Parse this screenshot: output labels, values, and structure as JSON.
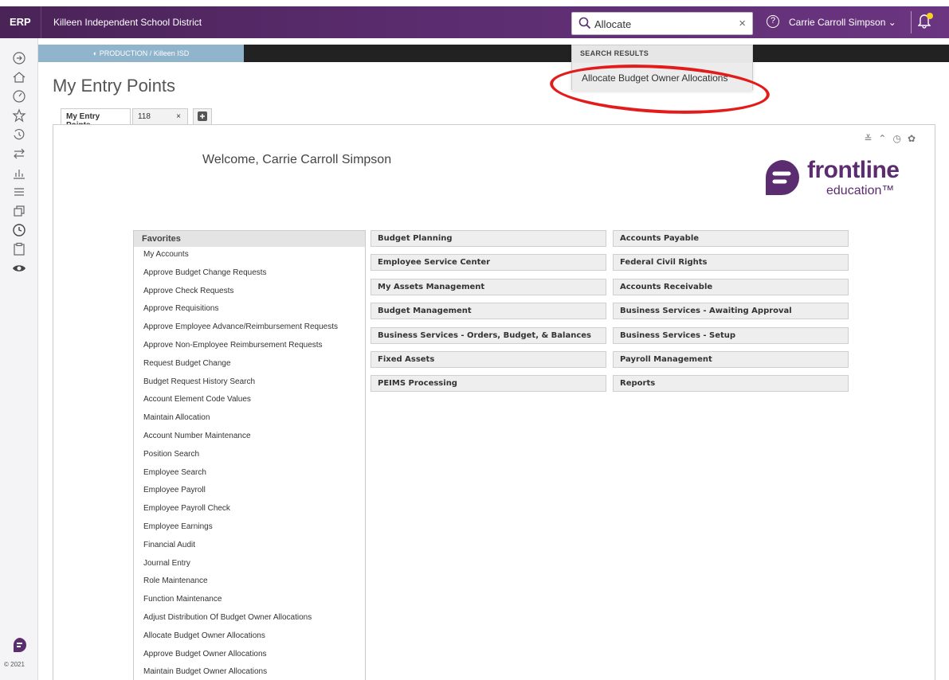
{
  "header": {
    "app": "ERP",
    "district": "Killeen Independent School District",
    "search_value": "Allocate",
    "user": "Carrie Carroll Simpson ⌄"
  },
  "env": {
    "label": "◐ PRODUCTION / Killeen ISD"
  },
  "search_results": {
    "header": "SEARCH RESULTS",
    "match": "Allocate",
    "rest": " Budget Owner Allocations"
  },
  "page": {
    "title": "My Entry Points",
    "tabs": [
      {
        "label": "My Entry Points"
      },
      {
        "label": "118"
      }
    ],
    "welcome": "Welcome, Carrie Carroll Simpson"
  },
  "brand": {
    "name": "frontline",
    "sub": "education™"
  },
  "favorites": {
    "title": "Favorites",
    "items": [
      "My Accounts",
      "Approve Budget Change Requests",
      "Approve Check Requests",
      "Approve Requisitions",
      "Approve Employee Advance/Reimbursement Requests",
      "Approve Non-Employee Reimbursement Requests",
      "Request Budget Change",
      "Budget Request History Search",
      "Account Element Code Values",
      "Maintain Allocation",
      "Account Number Maintenance",
      "Position Search",
      "Employee Search",
      "Employee Payroll",
      "Employee Payroll Check",
      "Employee Earnings",
      "Financial Audit",
      "Journal Entry",
      "Role Maintenance",
      "Function Maintenance",
      "Adjust Distribution Of Budget Owner Allocations",
      "Allocate Budget Owner Allocations",
      "Approve Budget Owner Allocations",
      "Maintain Budget Owner Allocations"
    ]
  },
  "modules": {
    "col1": [
      "Budget Planning",
      "Employee Service Center",
      "My Assets Management",
      "Budget Management",
      "Business Services - Orders, Budget, & Balances",
      "Fixed Assets",
      "PEIMS Processing"
    ],
    "col2": [
      "Accounts Payable",
      "Federal Civil Rights",
      "Accounts Receivable",
      "Business Services - Awaiting Approval",
      "Business Services - Setup",
      "Payroll Management",
      "Reports"
    ]
  },
  "footer": {
    "copyright": "© 2021"
  }
}
